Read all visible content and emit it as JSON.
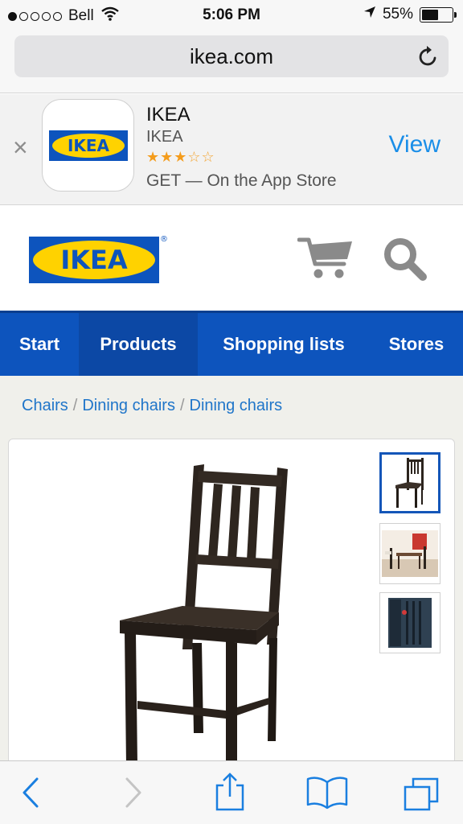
{
  "status_bar": {
    "carrier": "Bell",
    "time": "5:06 PM",
    "battery": "55%",
    "battery_level": 0.55,
    "signal_bars_filled": 1,
    "signal_bars_total": 5
  },
  "browser": {
    "url": "ikea.com",
    "reload_icon": "reload-icon"
  },
  "app_banner": {
    "app_name": "IKEA",
    "developer": "IKEA",
    "rating": 3,
    "rating_max": 5,
    "stars_filled": "★★★",
    "stars_empty": "☆☆",
    "store_text": "GET — On the App Store",
    "view_label": "View",
    "close_glyph": "×",
    "logo_text": "IKEA"
  },
  "site_header": {
    "logo_text": "IKEA",
    "registered_mark": "®",
    "cart_icon": "cart-icon",
    "search_icon": "search-icon"
  },
  "nav": {
    "tabs": [
      {
        "label": "Start",
        "active": false
      },
      {
        "label": "Products",
        "active": true
      },
      {
        "label": "Shopping lists",
        "active": false
      },
      {
        "label": "Stores",
        "active": false
      }
    ]
  },
  "breadcrumb": {
    "items": [
      "Chairs",
      "Dining chairs",
      "Dining chairs"
    ],
    "separator": "/"
  },
  "product": {
    "thumbnails": [
      "chair",
      "dining-room",
      "chair-closeup"
    ],
    "selected_thumbnail": 0
  },
  "toolbar": {
    "buttons": [
      "back-icon",
      "forward-icon",
      "share-icon",
      "bookmarks-icon",
      "tabs-icon"
    ]
  },
  "colors": {
    "ikea_blue": "#0d54bd",
    "ikea_yellow": "#ffd200",
    "link_blue": "#1f75c9",
    "ios_blue": "#1a8ee8",
    "star_orange": "#f49c1c"
  }
}
